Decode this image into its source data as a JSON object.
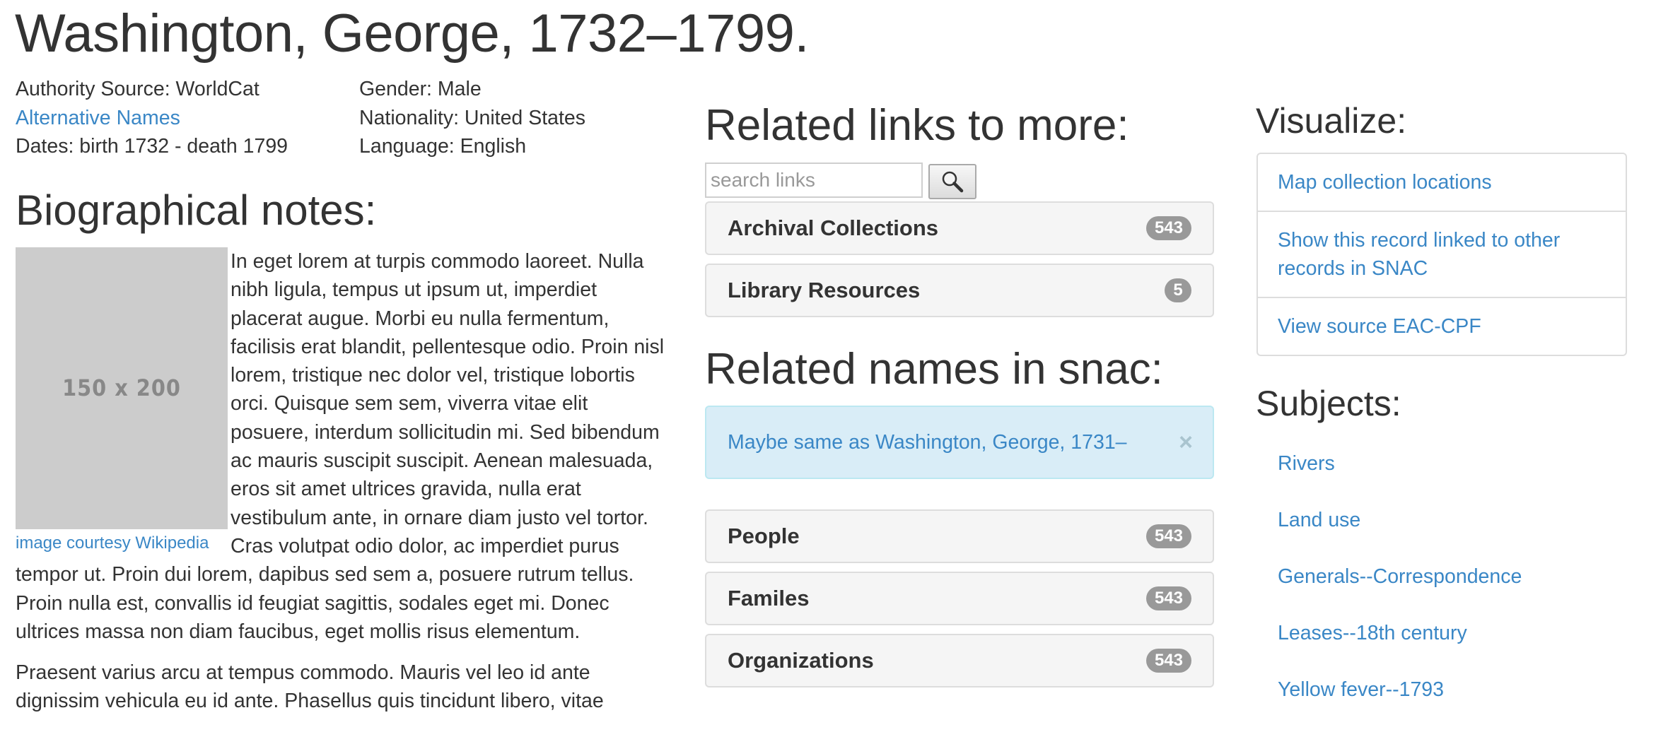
{
  "header": {
    "title": "Washington, George, 1732–1799."
  },
  "meta": {
    "authority_source": "Authority Source: WorldCat",
    "alternative_names": "Alternative Names",
    "dates": "Dates: birth 1732 - death 1799",
    "gender": "Gender: Male",
    "nationality": "Nationality: United States",
    "language": "Language: English"
  },
  "bio": {
    "heading": "Biographical notes:",
    "image_placeholder": "150 x 200",
    "image_caption": "image courtesy Wikipedia",
    "paragraphs": [
      "In eget lorem at turpis commodo laoreet. Nulla nibh ligula, tempus ut ipsum ut, imperdiet placerat augue. Morbi eu nulla fermentum, facilisis erat blandit, pellentesque odio. Proin nisl lorem, tristique nec dolor vel, tristique lobortis orci. Quisque sem sem, viverra vitae elit posuere, interdum sollicitudin mi. Sed bibendum ac mauris suscipit suscipit. Aenean malesuada, eros sit amet ultrices gravida, nulla erat vestibulum ante, in ornare diam justo vel tortor. Cras volutpat odio dolor, ac imperdiet purus tempor ut. Proin dui lorem, dapibus sed sem a, posuere rutrum tellus. Proin nulla est, convallis id feugiat sagittis, sodales eget mi. Donec ultrices massa non diam faucibus, eget mollis risus elementum.",
      "Praesent varius arcu at tempus commodo. Mauris vel leo id ante dignissim vehicula eu id ante. Phasellus quis tincidunt libero, vitae"
    ]
  },
  "related_links": {
    "heading": "Related links to more:",
    "search_placeholder": "search links",
    "search_icon": "magnifier-icon",
    "panels": [
      {
        "label": "Archival Collections",
        "count": "543"
      },
      {
        "label": "Library Resources",
        "count": "5"
      }
    ]
  },
  "related_names": {
    "heading": "Related names in snac:",
    "alert_text": "Maybe same as Washington, George, 1731–",
    "alert_close": "×",
    "panels": [
      {
        "label": "People",
        "count": "543"
      },
      {
        "label": "Familes",
        "count": "543"
      },
      {
        "label": "Organizations",
        "count": "543"
      }
    ]
  },
  "visualize": {
    "heading": "Visualize:",
    "items": [
      "Map collection locations",
      "Show this record linked to other records in SNAC",
      "View source EAC-CPF"
    ]
  },
  "subjects": {
    "heading": "Subjects:",
    "items": [
      "Rivers",
      "Land use",
      "Generals--Correspondence",
      "Leases--18th century",
      "Yellow fever--1793"
    ]
  },
  "colors": {
    "link": "#3a87c6",
    "text": "#333333",
    "badge": "#999999",
    "alert_bg": "#d9edf7",
    "alert_border": "#bce8f1",
    "panel_bg": "#f5f5f5",
    "placeholder_bg": "#cccccc"
  }
}
